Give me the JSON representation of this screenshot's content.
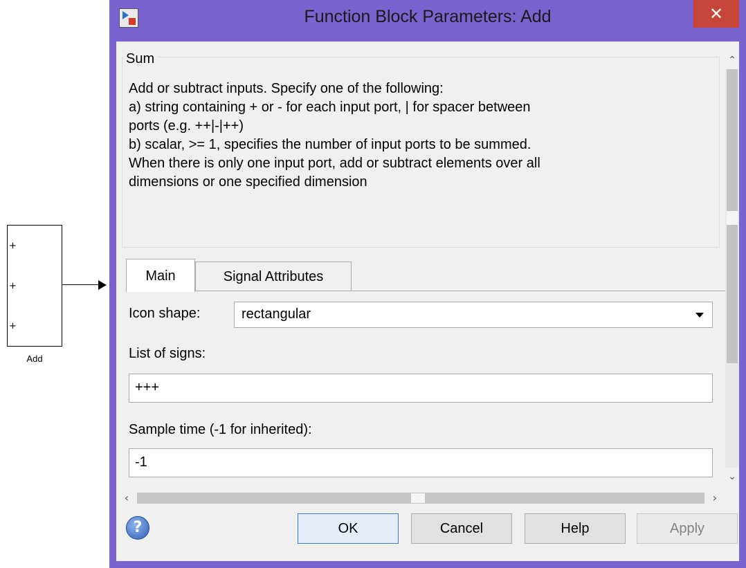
{
  "block": {
    "name": "Add",
    "port_signs": [
      "+",
      "+",
      "+"
    ]
  },
  "dialog": {
    "title": "Function Block Parameters: Add",
    "close_label": "✕",
    "group_title": "Sum",
    "description_lines": [
      "Add or subtract inputs.  Specify one of the following:",
      "a) string containing + or - for each input port, | for spacer between",
      "ports (e.g. ++|-|++)",
      "b) scalar, >= 1, specifies the number of input ports to be summed.",
      "When there is only one input port, add or subtract elements over all",
      "dimensions or one specified dimension"
    ],
    "tabs": [
      "Main",
      "Signal Attributes"
    ],
    "active_tab": "Main",
    "icon_shape_label": "Icon shape:",
    "icon_shape_value": "rectangular",
    "list_of_signs_label": "List of signs:",
    "list_of_signs_value": "+++",
    "sample_time_label": "Sample time (-1 for inherited):",
    "sample_time_value": "-1",
    "buttons": {
      "ok": "OK",
      "cancel": "Cancel",
      "help": "Help",
      "apply": "Apply"
    },
    "help_icon_glyph": "?"
  },
  "colors": {
    "title_bar": "#7a63cf",
    "close_button": "#c7463a",
    "dialog_background": "#f0f0f0"
  },
  "icons": [
    "simulink-app-icon",
    "close-icon",
    "help-icon",
    "chevron-down-icon",
    "scroll-up-icon",
    "scroll-down-icon",
    "scroll-left-icon",
    "scroll-right-icon"
  ]
}
